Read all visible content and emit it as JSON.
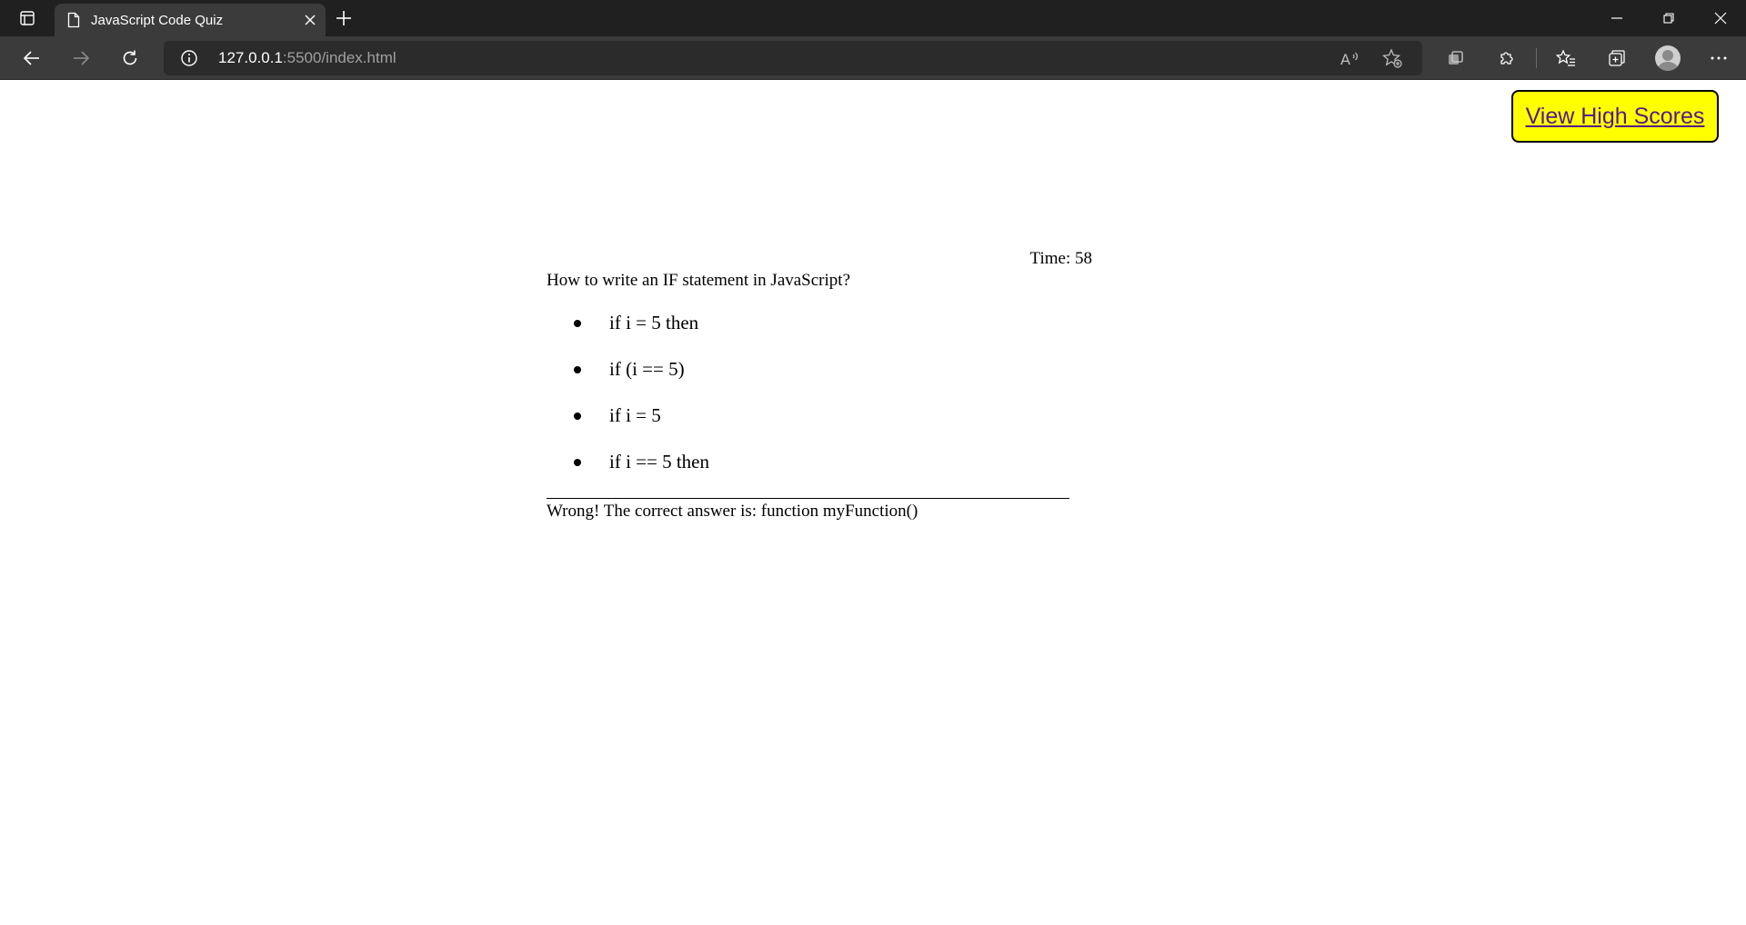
{
  "browser": {
    "tab_title": "JavaScript Code Quiz",
    "url_host": "127.0.0.1",
    "url_rest": ":5500/index.html",
    "icons": {
      "tab_actions": "tab-actions-icon",
      "page": "page-icon",
      "close": "close-icon",
      "new_tab": "plus-icon",
      "back": "back-arrow-icon",
      "forward": "forward-arrow-icon",
      "reload": "reload-icon",
      "info": "info-icon",
      "read_aloud": "read-aloud-icon",
      "favorite": "favorite-star-icon",
      "wallet": "wallet-icon",
      "extensions": "puzzle-icon",
      "favorites": "favorites-list-icon",
      "collections": "collections-icon",
      "profile": "profile-icon",
      "more": "more-icon"
    },
    "colors": {
      "tabbar": "#202020",
      "toolbar": "#3b3b3b",
      "address": "#2b2b2b"
    }
  },
  "page": {
    "high_scores_label": "View High Scores",
    "high_scores_bg": "#ffff00",
    "timer": "Time: 58",
    "question": "How to write an IF statement in JavaScript?",
    "choices": [
      "if i = 5 then",
      "if (i == 5)",
      "if i = 5",
      "if i == 5 then"
    ],
    "feedback": "Wrong! The correct answer is: function myFunction()"
  }
}
